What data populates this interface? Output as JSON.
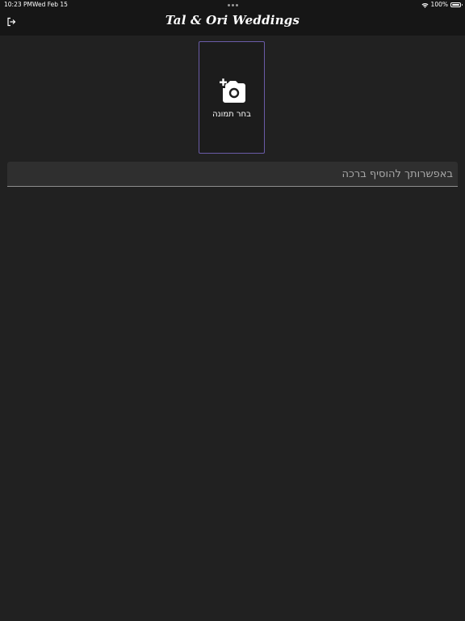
{
  "status_bar": {
    "time": "10:23 PM",
    "date": "Wed Feb 15",
    "battery": "100%",
    "icons": [
      "wifi-icon",
      "battery-icon"
    ]
  },
  "header": {
    "title": "Tal & Ori Weddings",
    "logout_icon": "logout-icon"
  },
  "image_picker": {
    "icon": "add-photo-icon",
    "label": "בחר תמונה"
  },
  "message_input": {
    "placeholder": "באפשרותך להוסיף ברכה",
    "value": ""
  },
  "colors": {
    "background": "#212121",
    "bar": "#161616",
    "picker_border": "#6a5ca8",
    "input_background": "#2f2f2f"
  }
}
